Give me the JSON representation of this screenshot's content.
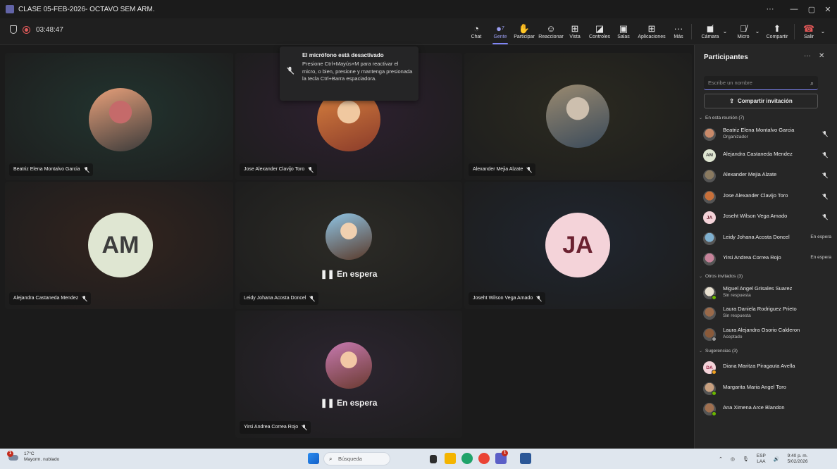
{
  "window": {
    "title": "CLASE 05-FEB-2026- OCTAVO SEM ARM.",
    "controls": [
      "···",
      "—",
      "▢",
      "✕"
    ]
  },
  "toolbar": {
    "timer": "03:48:47",
    "buttons": [
      {
        "label": "Chat",
        "icon": "chat-icon",
        "glyph": "☺"
      },
      {
        "label": "Gente",
        "icon": "people-icon",
        "glyph": "👤",
        "count": "7",
        "active": true
      },
      {
        "label": "Participar",
        "icon": "raise-hand-icon",
        "glyph": "✋"
      },
      {
        "label": "Reaccionar",
        "icon": "emoji-icon",
        "glyph": "☺"
      },
      {
        "label": "Vista",
        "icon": "view-grid-icon",
        "glyph": "⊞"
      },
      {
        "label": "Controles",
        "icon": "controls-icon",
        "glyph": "◪"
      },
      {
        "label": "Salas",
        "icon": "rooms-icon",
        "glyph": "▣"
      },
      {
        "label": "Aplicaciones",
        "icon": "apps-icon",
        "glyph": "⊞"
      },
      {
        "label": "Más",
        "icon": "more-icon",
        "glyph": "···"
      }
    ],
    "camera_label": "Cámara",
    "mic_label": "Micro",
    "share_label": "Compartir",
    "leave_label": "Salir"
  },
  "toast": {
    "title": "El micrófono está desactivado",
    "body": "Presione Ctrl+Mayús+M para reactivar el micro, o bien, presione y mantenga presionada la tecla Ctrl+Barra espaciadora."
  },
  "tiles": [
    {
      "name": "Beatriz Elena Montalvo Garcia",
      "kind": "photo",
      "photo_colors": [
        "#e8a07a",
        "#3a3a3a",
        "#c56a6a"
      ],
      "bg": "#22342f"
    },
    {
      "name": "Jose Alexander Clavijo Toro",
      "kind": "photo",
      "photo_colors": [
        "#d9823f",
        "#8a3b2a",
        "#f0c8a0"
      ],
      "bg": "#2e2030"
    },
    {
      "name": "Alexander Mejia Alzate",
      "kind": "photo",
      "photo_colors": [
        "#9a8a70",
        "#3a4a5a",
        "#cdbfae"
      ],
      "bg": "#2b2a20"
    },
    {
      "name": "Alejandra Castaneda Mendez",
      "kind": "initials",
      "initials": "AM",
      "bg": "#33241f",
      "avatar_bg": "#dfe6d2",
      "avatar_fg": "#3d3d3d"
    },
    {
      "name": "Leidy Johana Acosta Doncel",
      "kind": "photo",
      "waiting": "En espera",
      "photo_colors": [
        "#8fc4e4",
        "#5a3a2a",
        "#f0d0b0"
      ],
      "bg": "#2c2b26"
    },
    {
      "name": "Joseht Wilson Vega Amado",
      "kind": "initials",
      "initials": "JA",
      "bg": "#202630",
      "avatar_bg": "#f4d3d9",
      "avatar_fg": "#6b2130"
    },
    {
      "name": "Yirsi Andrea Correa Rojo",
      "kind": "photo",
      "waiting": "En espera",
      "photo_colors": [
        "#c77ab0",
        "#6a3a30",
        "#f2c7a5"
      ],
      "bg": "#2c2530"
    }
  ],
  "panel": {
    "title": "Participantes",
    "search_placeholder": "Escribe un nombre",
    "invite_label": "Compartir invitación",
    "sections": [
      {
        "title": "En esta reunión (7)",
        "people": [
          {
            "name": "Beatriz Elena Montalvo Garcia",
            "sub": "Organizador",
            "status": "",
            "muted": true,
            "avatar": "photo",
            "color": "#c98a6a"
          },
          {
            "name": "Alejandra Castaneda Mendez",
            "sub": "",
            "status": "",
            "muted": true,
            "avatar": "initials",
            "initials": "AM",
            "color": "#dfe6d2",
            "fg": "#3d3d3d"
          },
          {
            "name": "Alexander Mejia Alzate",
            "sub": "",
            "status": "",
            "muted": true,
            "avatar": "photo",
            "color": "#8a7a60"
          },
          {
            "name": "Jose Alexander Clavijo Toro",
            "sub": "",
            "status": "",
            "muted": true,
            "avatar": "photo",
            "color": "#c8703a"
          },
          {
            "name": "Joseht Wilson Vega Amado",
            "sub": "",
            "status": "",
            "muted": true,
            "avatar": "initials",
            "initials": "JA",
            "color": "#f4d3d9",
            "fg": "#6b2130"
          },
          {
            "name": "Leidy Johana Acosta Doncel",
            "sub": "",
            "status": "En espera",
            "muted": false,
            "avatar": "photo",
            "color": "#7fb0cf"
          },
          {
            "name": "Yirsi Andrea Correa Rojo",
            "sub": "",
            "status": "En espera",
            "muted": false,
            "avatar": "photo",
            "color": "#c7839a"
          }
        ]
      },
      {
        "title": "Otros invitados (3)",
        "people": [
          {
            "name": "Miguel Angel Grisales Suarez",
            "sub": "Sin respuesta",
            "status": "",
            "muted": false,
            "avatar": "photo",
            "color": "#e8e0d0",
            "presence": "#6bb700"
          },
          {
            "name": "Laura Daniela Rodriguez Prieto",
            "sub": "Sin respuesta",
            "status": "",
            "muted": false,
            "avatar": "photo",
            "color": "#9a6a4a"
          },
          {
            "name": "Laura Alejandra Osorio Calderon",
            "sub": "Aceptado",
            "status": "",
            "muted": false,
            "avatar": "photo",
            "color": "#8a5a3a",
            "presence": "#9a9a9a"
          }
        ]
      },
      {
        "title": "Sugerencias (3)",
        "people": [
          {
            "name": "Diana Maritza Piragauta Avella",
            "sub": "",
            "status": "",
            "muted": false,
            "avatar": "initials",
            "initials": "DA",
            "color": "#f4d3d9",
            "fg": "#9a2040",
            "presence": "#f0a020"
          },
          {
            "name": "Margarita Maria Angel Toro",
            "sub": "",
            "status": "",
            "muted": false,
            "avatar": "photo",
            "color": "#c8a080",
            "presence": "#6bb700"
          },
          {
            "name": "Ana Ximena Arce Blandon",
            "sub": "",
            "status": "",
            "muted": false,
            "avatar": "photo",
            "color": "#a07050",
            "presence": "#6bb700"
          }
        ]
      }
    ]
  },
  "taskbar": {
    "temperature": "17°C",
    "weather": "Mayorm. nublado",
    "weather_badge": "1",
    "search_label": "Búsqueda",
    "lang_top": "ESP",
    "lang_bottom": "LAA",
    "time": "9:40 p. m.",
    "date": "5/02/2026",
    "teams_badge": "1"
  },
  "colors": {
    "accent": "#7f85f5",
    "hangup": "#c4314b",
    "panel_bg": "#262626"
  }
}
